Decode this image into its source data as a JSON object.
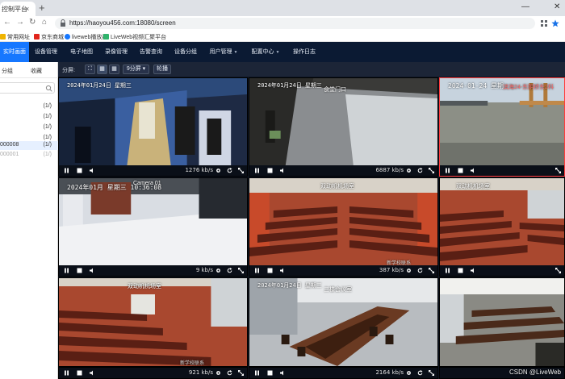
{
  "browser": {
    "tab_title": "控制平台",
    "url": "https://haoyou456.com:18080/screen",
    "bookmarks": [
      {
        "label": "常用网址",
        "color": "#f0b400"
      },
      {
        "label": "京东商城",
        "color": "#e1251b"
      },
      {
        "label": "liveweb播放器",
        "color": "#1677ff"
      },
      {
        "label": "LiveWeb视频汇聚平台",
        "color": "#2fb36b"
      }
    ]
  },
  "nav": {
    "items": [
      {
        "label": "实时画面",
        "active": true
      },
      {
        "label": "设备管理"
      },
      {
        "label": "电子地图"
      },
      {
        "label": "录像管理"
      },
      {
        "label": "告警查询"
      },
      {
        "label": "设备分组"
      },
      {
        "label": "用户管理",
        "dropdown": true
      },
      {
        "label": "配置中心",
        "dropdown": true
      },
      {
        "label": "操作日志"
      }
    ]
  },
  "left_panel": {
    "tabs": [
      "分组",
      "收藏"
    ],
    "tree": [
      {
        "label": "",
        "count": "(1/)"
      },
      {
        "label": "",
        "count": "(1/)"
      },
      {
        "label": "",
        "count": "(1/)"
      },
      {
        "label": "",
        "count": "(1/)"
      },
      {
        "label": "000008",
        "count": "(1/)",
        "selected": true
      },
      {
        "label": "000001",
        "count": "(1/)",
        "dim": true
      }
    ]
  },
  "toolbar": {
    "split_label": "分屏:",
    "split_select": "9分屏",
    "carousel_button": "轮播"
  },
  "cells": [
    {
      "osd": "2024年01月24日 星期三",
      "label": "",
      "bitrate": "1276 kb/s",
      "scene": "corridor"
    },
    {
      "osd": "2024年01月24日 星期三",
      "label": "食堂门口",
      "bitrate": "6887 kb/s",
      "scene": "snow"
    },
    {
      "osd": "2024-01-24 星期",
      "label": "滨海24-东阴桥东2科",
      "bitrate": "",
      "scene": "river",
      "selected": true
    },
    {
      "osd": "2024年01月 星期三 10:36:08",
      "label": "Camera 01",
      "bitrate": "9 kb/s",
      "scene": "lobby"
    },
    {
      "osd": "",
      "label": "双动机机场室",
      "bitrate": "387 kb/s",
      "scene": "hall",
      "sub": "新学校联系"
    },
    {
      "osd": "",
      "label": "双动机机场室",
      "bitrate": "",
      "scene": "hall2"
    },
    {
      "osd": "",
      "label": "双动机机场室",
      "bitrate": "921 kb/s",
      "scene": "hall3",
      "sub": "新学校联系"
    },
    {
      "osd": "2024年01月24日 星期三",
      "label": "三楼会议室",
      "bitrate": "2164 kb/s",
      "scene": "meeting"
    },
    {
      "osd": "",
      "label": "",
      "bitrate": "",
      "scene": "classroom"
    }
  ],
  "watermark": "CSDN @LiveWeb"
}
